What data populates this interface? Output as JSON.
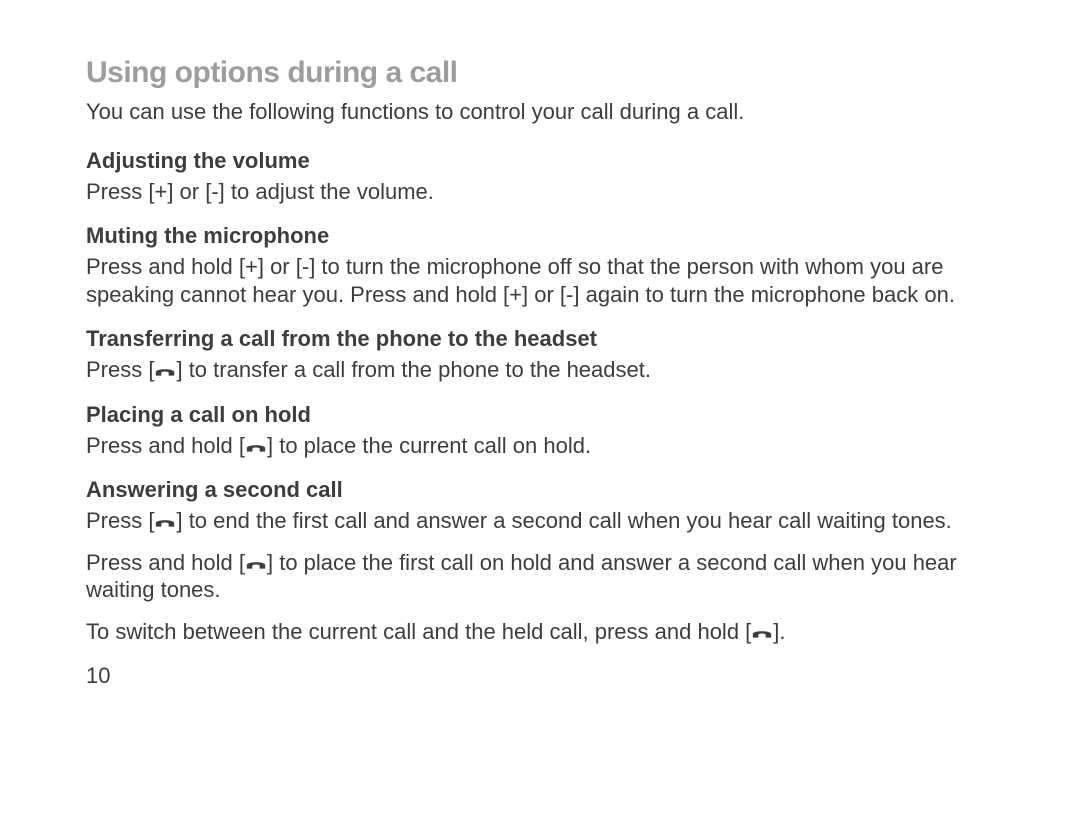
{
  "title": "Using options during a call",
  "intro": "You can use the following functions to control your call during a call.",
  "keys": {
    "plus": "+",
    "minus": "-"
  },
  "sections": {
    "volume": {
      "heading": "Adjusting the volume",
      "body": {
        "pre": "Press [",
        "mid1": "] or [",
        "post": "] to adjust the volume."
      }
    },
    "mute": {
      "heading": "Muting the microphone",
      "body": {
        "pre": "Press and hold [",
        "mid1": "] or [",
        "mid2": "] to turn the microphone off so that the person with whom you are speaking cannot hear you. Press and hold [",
        "mid3": "] or [",
        "post": "] again to turn the microphone back on."
      }
    },
    "transfer": {
      "heading": "Transferring a call from the phone to the headset",
      "body": {
        "pre": "Press [",
        "post": "] to transfer a call from the phone to the headset."
      }
    },
    "hold": {
      "heading": "Placing a call on hold",
      "body": {
        "pre": "Press and hold [",
        "post": "] to place the current call on hold."
      }
    },
    "second": {
      "heading": "Answering a second call",
      "p1": {
        "pre": "Press [",
        "post": "] to end the first call and answer a second call when you hear call waiting tones."
      },
      "p2": {
        "pre": "Press and hold [",
        "post": "] to place the first call on hold and answer a second call when you hear waiting tones."
      },
      "p3": {
        "pre": "To switch between the current call and the held call, press and hold [",
        "post": "]."
      }
    }
  },
  "page_number": "10"
}
